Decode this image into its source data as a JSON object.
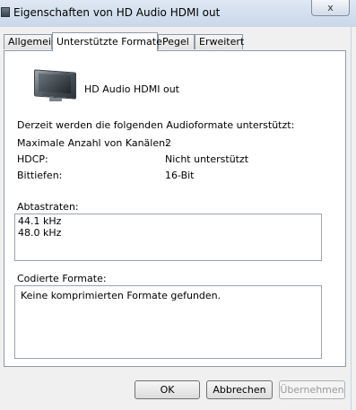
{
  "window": {
    "title": "Eigenschaften von HD Audio HDMI out",
    "close_label": "x"
  },
  "tabs": [
    {
      "label": "Allgemein"
    },
    {
      "label": "Unterstützte Formate"
    },
    {
      "label": "Pegel"
    },
    {
      "label": "Erweitert"
    }
  ],
  "device": {
    "name": "HD Audio HDMI out",
    "icon": "monitor-icon"
  },
  "formats": {
    "intro": "Derzeit werden die folgenden Audioformate unterstützt:",
    "rows": [
      {
        "label": "Maximale Anzahl von Kanälen:",
        "value": "2"
      },
      {
        "label": "HDCP:",
        "value": "Nicht unterstützt"
      },
      {
        "label": "Bittiefen:",
        "value": "16-Bit"
      }
    ]
  },
  "sample_rates": {
    "label": "Abtastraten:",
    "items": [
      "44.1 kHz",
      "48.0 kHz"
    ]
  },
  "encoded": {
    "label": "Codierte Formate:",
    "text": "Keine komprimierten Formate gefunden."
  },
  "buttons": {
    "ok": "OK",
    "cancel": "Abbrechen",
    "apply": "Übernehmen"
  }
}
